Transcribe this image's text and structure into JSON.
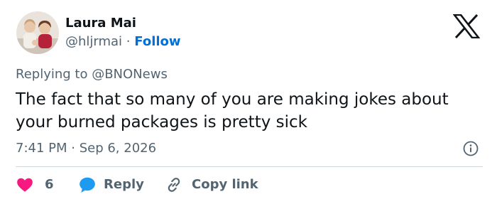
{
  "author": {
    "name": "Laura Mai",
    "handle": "@hljrmai",
    "separator": "·",
    "follow_label": "Follow"
  },
  "reply_context": "Replying to @BNONews",
  "tweet_text": "The fact that so many of you are making jokes about your burned packages is pretty sick",
  "timestamp": "7:41 PM · Sep 6, 2026",
  "actions": {
    "like_count": "6",
    "reply_label": "Reply",
    "copy_link_label": "Copy link"
  },
  "colors": {
    "text": "#0f1419",
    "secondary_text": "#536471",
    "link": "#006fd6",
    "like": "#f91880",
    "reply": "#1d9bf0",
    "divider": "#cfd9de"
  },
  "icons": [
    "avatar-photo",
    "x-logo-icon",
    "info-icon",
    "heart-icon",
    "reply-bubble-icon",
    "link-icon"
  ]
}
